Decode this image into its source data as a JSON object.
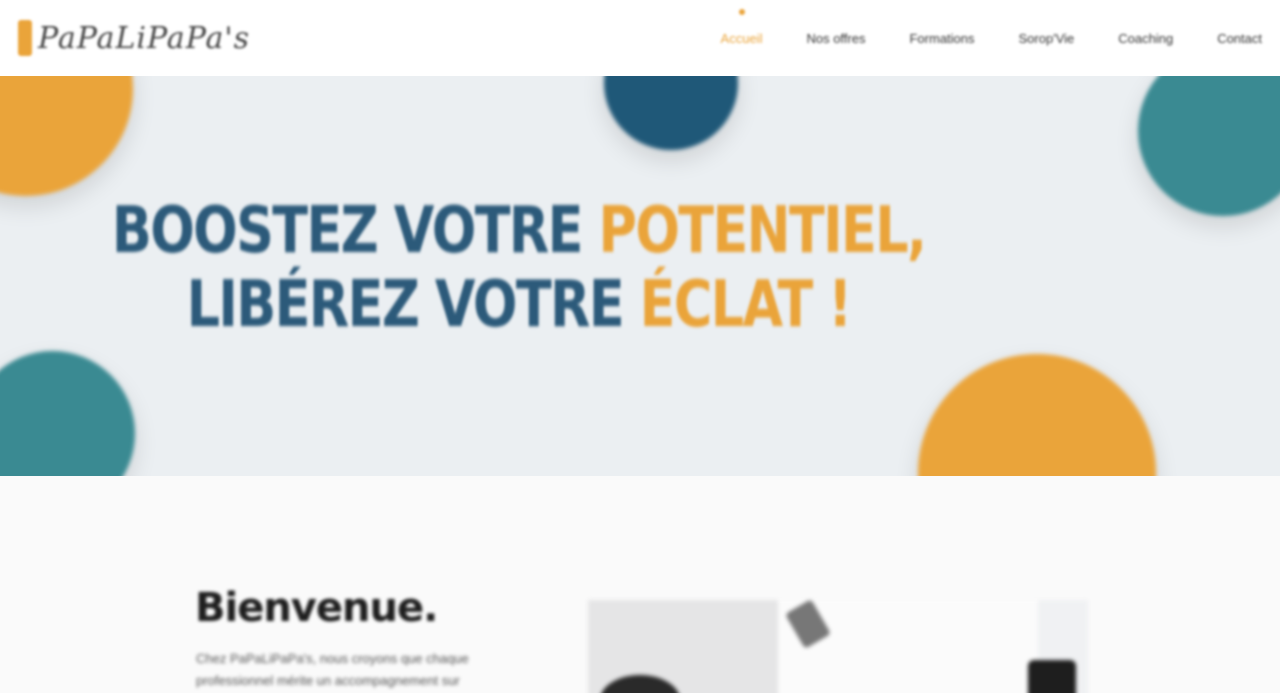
{
  "header": {
    "logo_text": "PaPaLiPaPa's",
    "nav": [
      {
        "label": "Accueil",
        "active": true
      },
      {
        "label": "Nos offres"
      },
      {
        "label": "Formations"
      },
      {
        "label": "Sorop'Vie"
      },
      {
        "label": "Coaching"
      },
      {
        "label": "Contact"
      }
    ]
  },
  "hero": {
    "line1_a": "BOOSTEZ VOTRE ",
    "line1_b": "POTENTIEL,",
    "line2_a": "LIBÉREZ VOTRE ",
    "line2_b": "ÉCLAT !"
  },
  "welcome": {
    "title": "Bienvenue.",
    "text": "Chez PaPaLiPaPa's, nous croyons que chaque professionnel mérite un accompagnement sur mesure"
  },
  "colors": {
    "accent_orange": "#eaa43a",
    "dark_blue": "#1f5878",
    "teal": "#3a8a92",
    "title_blue": "#2c5a7a"
  }
}
